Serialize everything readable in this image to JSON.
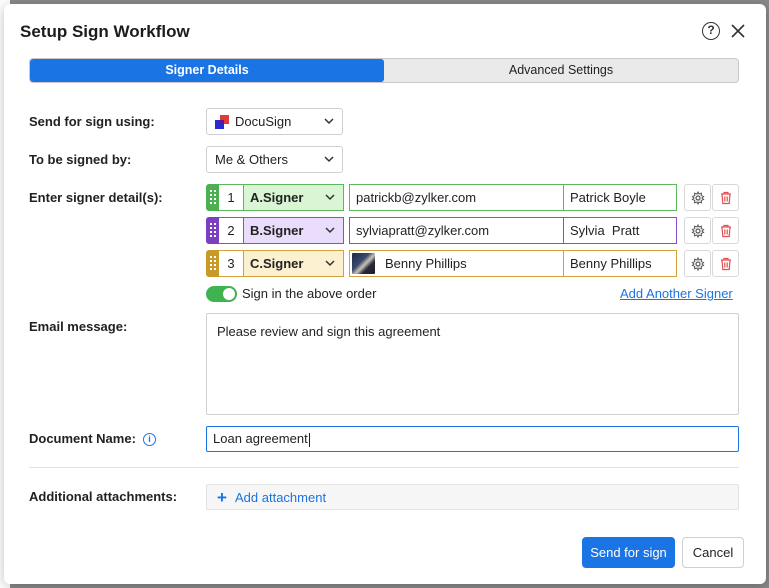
{
  "dialog": {
    "title": "Setup Sign Workflow",
    "help_glyph": "?",
    "close_icon": "close-icon"
  },
  "tabs": [
    {
      "label": "Signer Details",
      "active": true
    },
    {
      "label": "Advanced Settings",
      "active": false
    }
  ],
  "form": {
    "send_using_label": "Send for sign using:",
    "send_using_value": "DocuSign",
    "signed_by_label": "To be signed by:",
    "signed_by_value": "Me & Others",
    "signer_details_label": "Enter signer detail(s):",
    "signers": [
      {
        "order": "1",
        "role": "A.Signer",
        "email": "patrickb@zylker.com",
        "name": "Patrick Boyle",
        "color": "#4caf50"
      },
      {
        "order": "2",
        "role": "B.Signer",
        "email": "sylviapratt@zylker.com",
        "name": "Sylvia  Pratt",
        "color": "#7b3fbf"
      },
      {
        "order": "3",
        "role": "C.Signer",
        "email": "Benny Phillips",
        "name": "Benny Phillips",
        "color": "#c99a27"
      }
    ],
    "sign_order_label": "Sign in the above order",
    "sign_order_enabled": true,
    "add_signer_label": "Add Another Signer",
    "email_message_label": "Email message:",
    "email_message_value": "Please review and sign this agreement",
    "document_name_label": "Document Name:",
    "document_name_value": "Loan agreement",
    "info_glyph": "i",
    "attachments_label": "Additional attachments:",
    "add_attachment_label": "Add attachment"
  },
  "footer": {
    "send_label": "Send for sign",
    "cancel_label": "Cancel"
  },
  "colors": {
    "accent": "#1a74e4",
    "toggle_on": "#3fb34f",
    "delete": "#e05050"
  }
}
